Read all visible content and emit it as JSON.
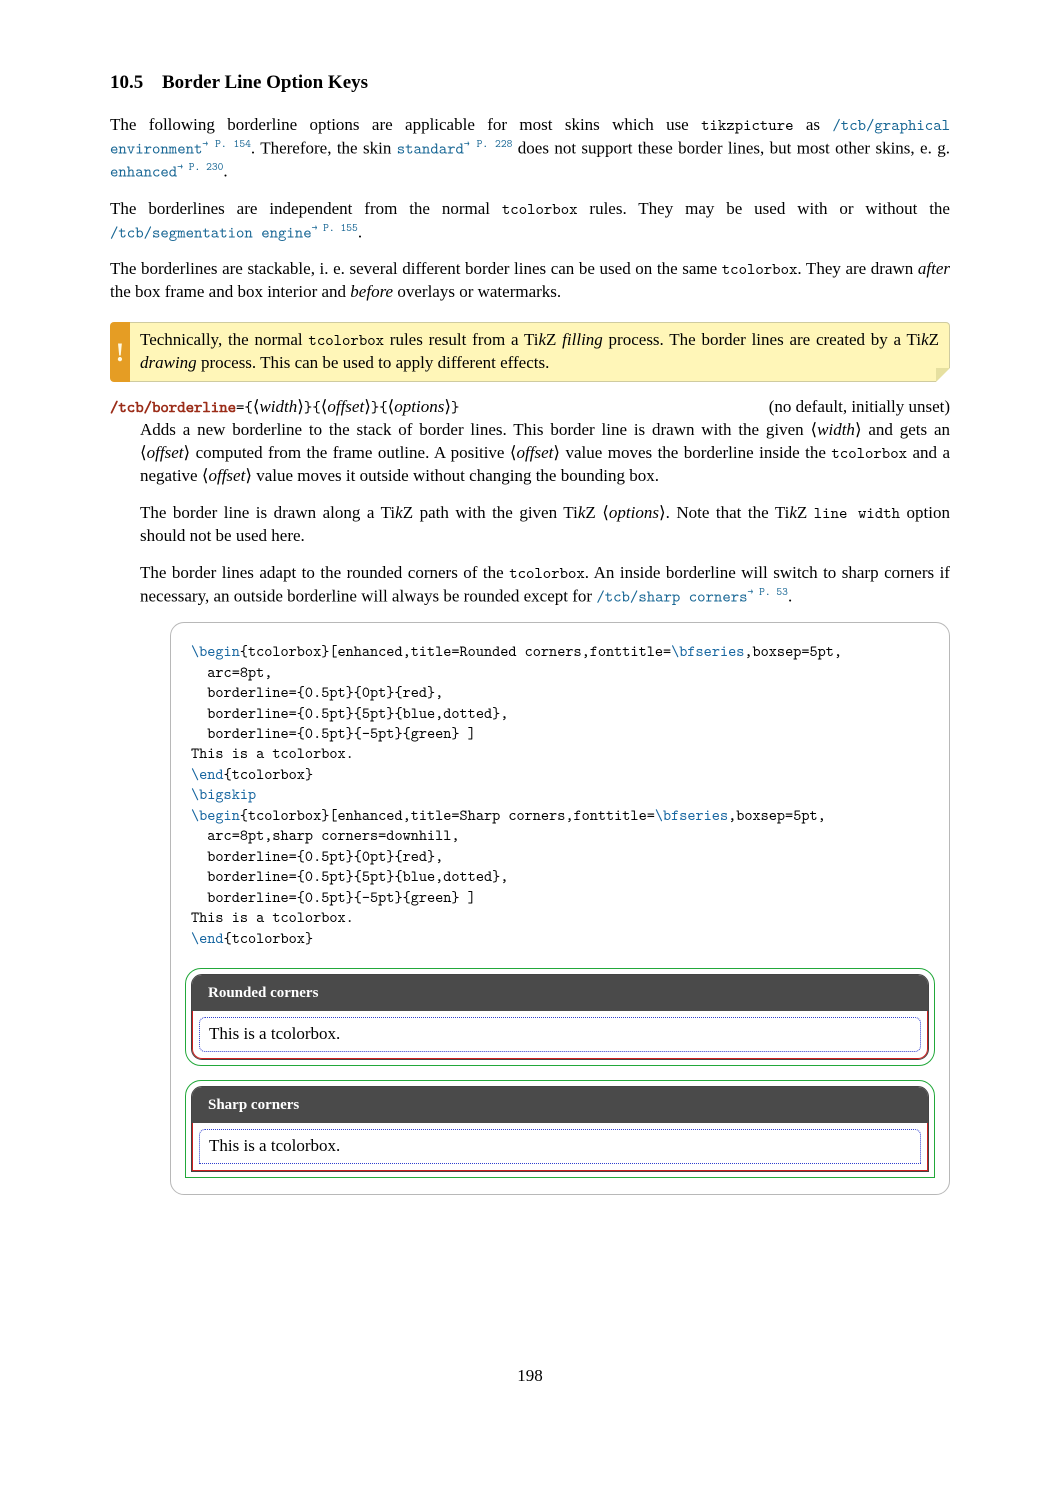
{
  "section": {
    "number": "10.5",
    "title": "Border Line Option Keys"
  },
  "para1": {
    "a": "The following borderline options are applicable for most skins which use ",
    "tt1": "tikzpicture",
    "b": " as ",
    "lnk1": "/tcb/graphical environment",
    "ref1": "→ P. 154",
    "c": ". Therefore, the skin ",
    "lnk2": "standard",
    "ref2": "→ P. 228",
    "d": " does not support these border lines, but most other skins, e. g. ",
    "lnk3": "enhanced",
    "ref3": "→ P. 230",
    "e": "."
  },
  "para2": {
    "a": "The borderlines are independent from the normal ",
    "tt1": "tcolorbox",
    "b": " rules. They may be used with or without the ",
    "lnk1": "/tcb/segmentation engine",
    "ref1": "→ P. 155",
    "c": "."
  },
  "para3": {
    "a": "The borderlines are stackable, i. e. several different border lines can be used on the same ",
    "tt1": "tcolorbox",
    "b": ". They are drawn ",
    "i1": "after",
    "c": " the box frame and box interior and ",
    "i2": "before",
    "d": " overlays or watermarks."
  },
  "warn": {
    "a": "Technically, the normal ",
    "tt1": "tcolorbox",
    "b": " rules result from a Ti",
    "k1": "k",
    "z1": "Z ",
    "i1": "filling",
    "c": " process. The border lines are created by a Ti",
    "k2": "k",
    "z2": "Z ",
    "i2": "drawing",
    "d": " process. This can be used to apply different effects."
  },
  "key": {
    "name": "/tcb/borderline",
    "eq": "=",
    "br_o": "{",
    "br_c": "}",
    "a1": "width",
    "a2": "offset",
    "a3": "options",
    "right": "(no default, initially unset)"
  },
  "desc": {
    "p1a": "Adds a new borderline to the stack of border lines. This border line is drawn with the given ⟨",
    "p1w": "width",
    "p1b": "⟩ and gets an ⟨",
    "p1o": "offset",
    "p1c": "⟩ computed from the frame outline. A positive ⟨",
    "p1o2": "offset",
    "p1d": "⟩ value moves the borderline inside the ",
    "p1tt": "tcolorbox",
    "p1e": " and a negative ⟨",
    "p1o3": "offset",
    "p1f": "⟩ value moves it outside without changing the bounding box.",
    "p2a": "The border line is drawn along a Ti",
    "p2k": "k",
    "p2z": "Z path with the given Ti",
    "p2k2": "k",
    "p2z2": "Z ⟨",
    "p2opt": "options",
    "p2b": "⟩. Note that the Ti",
    "p2k3": "k",
    "p2z3": "Z ",
    "p2tt": "line width",
    "p2c": " option should not be used here.",
    "p3a": "The border lines adapt to the rounded corners of the ",
    "p3tt": "tcolorbox",
    "p3b": ". An inside borderline will switch to sharp corners if necessary, an outside borderline will always be rounded except for ",
    "p3lnk": "/tcb/sharp corners",
    "p3ref": "→ P. 53",
    "p3c": "."
  },
  "code": {
    "l01a": "\\begin",
    "l01b": "{tcolorbox}[enhanced,title=Rounded corners,fonttitle=",
    "l01c": "\\bfseries",
    "l01d": ",boxsep=5pt,",
    "l02": "  arc=8pt,",
    "l03": "  borderline={0.5pt}{0pt}{red},",
    "l04": "  borderline={0.5pt}{5pt}{blue,dotted},",
    "l05": "  borderline={0.5pt}{-5pt}{green} ]",
    "l06": "This is a tcolorbox.",
    "l07a": "\\end",
    "l07b": "{tcolorbox}",
    "l08": "\\bigskip",
    "l09a": "\\begin",
    "l09b": "{tcolorbox}[enhanced,title=Sharp corners,fonttitle=",
    "l09c": "\\bfseries",
    "l09d": ",boxsep=5pt,",
    "l10": "  arc=8pt,sharp corners=downhill,",
    "l11": "  borderline={0.5pt}{0pt}{red},",
    "l12": "  borderline={0.5pt}{5pt}{blue,dotted},",
    "l13": "  borderline={0.5pt}{-5pt}{green} ]",
    "l14": "This is a tcolorbox.",
    "l15a": "\\end",
    "l15b": "{tcolorbox}"
  },
  "render": {
    "title1": "Rounded corners",
    "body1": "This is a tcolorbox.",
    "title2": "Sharp corners",
    "body2": "This is a tcolorbox."
  },
  "page": "198"
}
